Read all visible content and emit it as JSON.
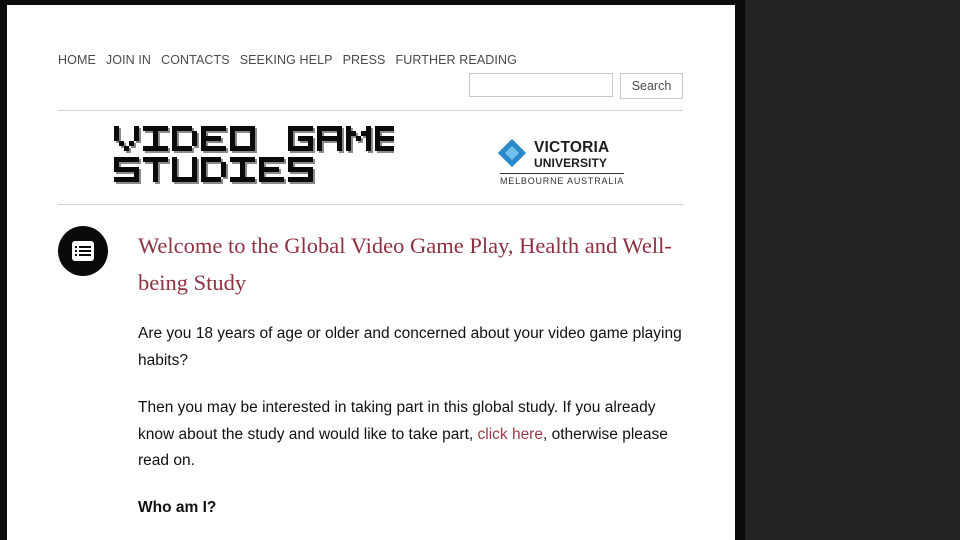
{
  "nav": {
    "items": [
      "HOME",
      "JOIN IN",
      "CONTACTS",
      "SEEKING HELP",
      "PRESS",
      "FURTHER READING"
    ]
  },
  "search": {
    "button_label": "Search",
    "placeholder": "",
    "value": ""
  },
  "header": {
    "site_logo": {
      "line1": "VIDEO GAME",
      "line2": "STUDIES"
    },
    "partner_logo": {
      "name_line1": "VICTORIA",
      "name_line2": "UNIVERSITY",
      "subtitle": "MELBOURNE AUSTRALIA",
      "diamond_color": "#2b88c8"
    }
  },
  "post": {
    "icon": "document-list-icon",
    "title": "Welcome to the Global Video Game Play, Health and Well-being Study",
    "paragraph1": "Are you 18 years of age or older and concerned about your video game playing habits?",
    "paragraph2_before": "Then you may be interested in taking part in this global study. If you already know about the study and would like to take part, ",
    "paragraph2_link": "click here",
    "paragraph2_after": ", otherwise please read on.",
    "subheading": "Who am I?"
  },
  "colors": {
    "title": "#8e3140",
    "link": "#9c3a47",
    "background": "#222325"
  }
}
